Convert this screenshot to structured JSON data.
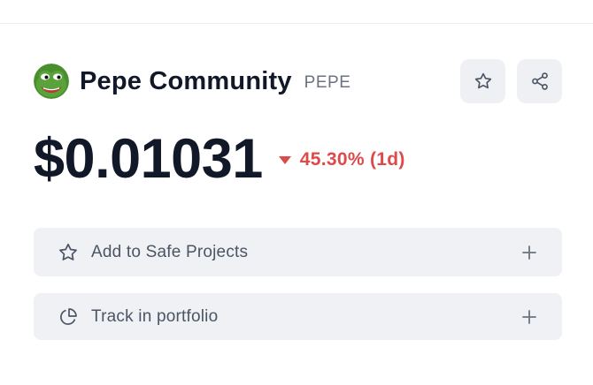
{
  "coin": {
    "name": "Pepe Community",
    "symbol": "PEPE",
    "logo_icon": "pepe-frog-icon"
  },
  "toolbar": {
    "watch_icon": "star-outline-icon",
    "share_icon": "share-icon"
  },
  "price": {
    "value": "$0.01031",
    "change": "45.30% (1d)",
    "direction": "down",
    "change_color": "#dc4a4a"
  },
  "actions": [
    {
      "label": "Add to Safe Projects",
      "icon": "star-outline-icon",
      "trailing_icon": "plus-icon"
    },
    {
      "label": "Track in portfolio",
      "icon": "pie-chart-icon",
      "trailing_icon": "plus-icon"
    }
  ],
  "colors": {
    "text_primary": "#111827",
    "text_secondary": "#6b7280",
    "button_bg": "#eef0f4",
    "negative": "#dc4a4a"
  }
}
